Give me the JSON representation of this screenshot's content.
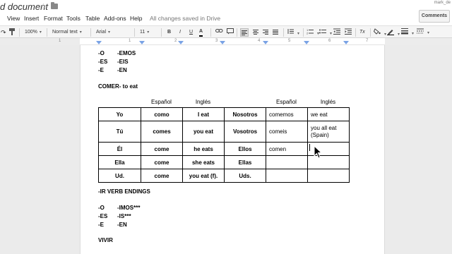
{
  "title_bar": {
    "document_title": "d document",
    "user": "mark_de"
  },
  "menu": {
    "items": [
      "View",
      "Insert",
      "Format",
      "Tools",
      "Table",
      "Add-ons",
      "Help"
    ],
    "save_status": "All changes saved in Drive",
    "comments_label": "Comments"
  },
  "toolbar": {
    "zoom": "100%",
    "style": "Normal text",
    "font": "Arial",
    "size": "11",
    "bold": "B",
    "italic": "I",
    "underline": "U",
    "text_color": "A",
    "clear_formatting": "Tx"
  },
  "ruler": {
    "numbers": [
      "1",
      "1",
      "2",
      "3",
      "4",
      "5",
      "6",
      "7"
    ]
  },
  "document": {
    "er_endings": [
      {
        "subject": "-O",
        "ending": "-EMOS"
      },
      {
        "subject": "-ES",
        "ending": "-EIS"
      },
      {
        "subject": "-E",
        "ending": "-EN"
      }
    ],
    "comer_heading": "COMER- to eat",
    "table_headers": [
      "Español",
      "Inglés",
      "Español",
      "Inglés"
    ],
    "table_rows": [
      [
        "Yo",
        "como",
        "I eat",
        "Nosotros",
        "comemos",
        "we eat"
      ],
      [
        "Tú",
        "comes",
        "you eat",
        "Vosotros",
        "comeis",
        "you all eat (Spain)"
      ],
      [
        "Él",
        "come",
        "he eats",
        "Ellos",
        "comen",
        ""
      ],
      [
        "Ella",
        "come",
        "she eats",
        "Ellas",
        "",
        ""
      ],
      [
        "Ud.",
        "come",
        "you eat (f).",
        "Uds.",
        "",
        ""
      ]
    ],
    "ir_heading": "-IR VERB ENDINGS",
    "ir_endings": [
      {
        "subject": "-O",
        "ending": "-IMOS***"
      },
      {
        "subject": "-ES",
        "ending": "-IS***"
      },
      {
        "subject": "-E",
        "ending": "-EN"
      }
    ],
    "vivir_heading": "VIVIR"
  }
}
